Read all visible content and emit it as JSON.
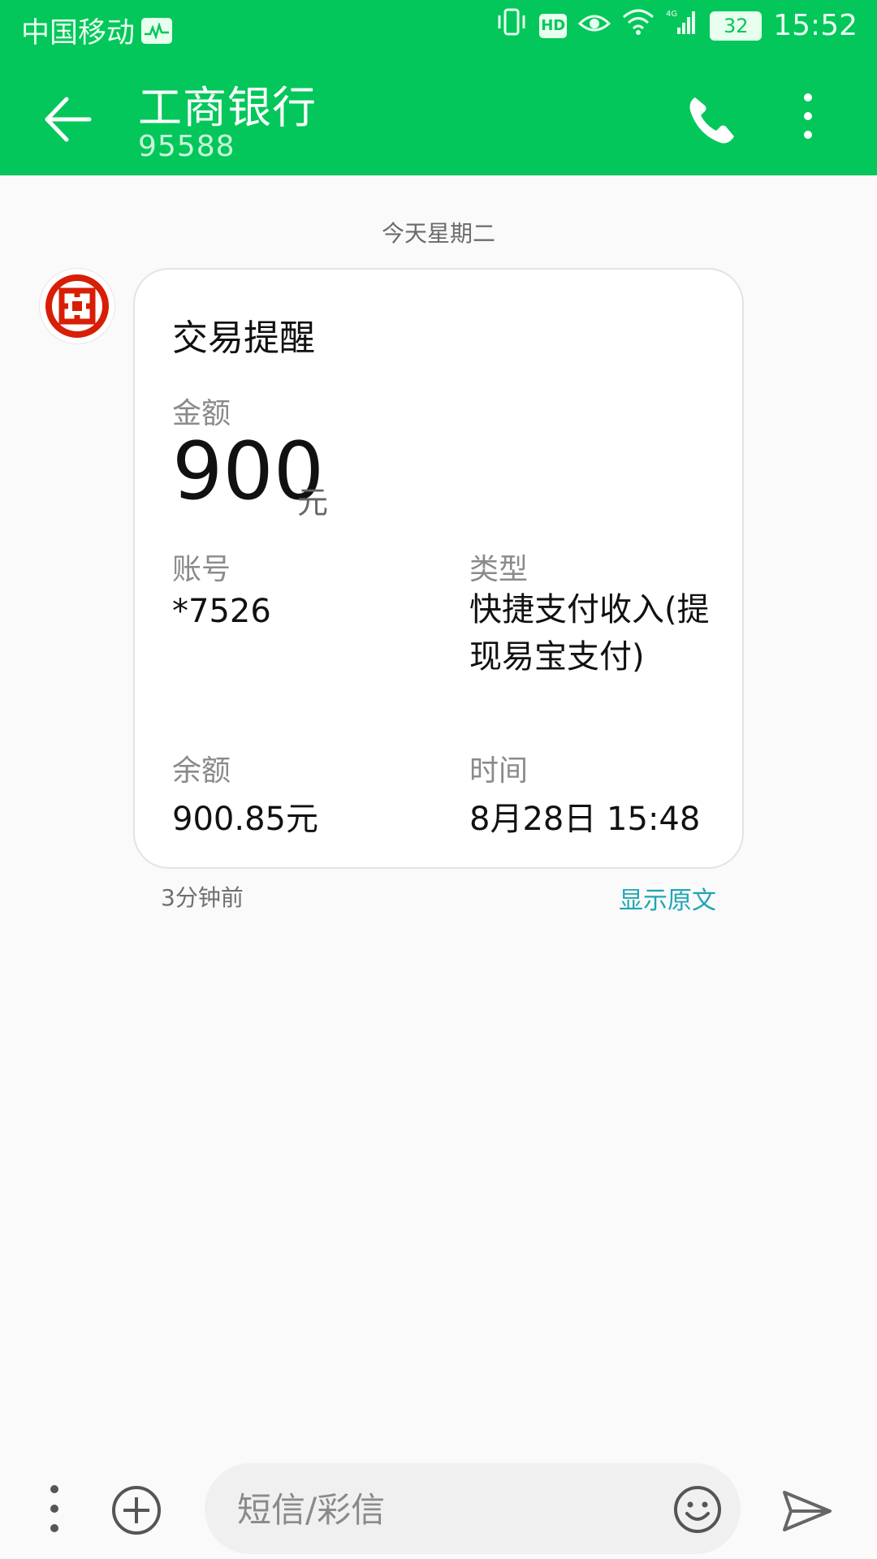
{
  "status_bar": {
    "carrier": "中国移动",
    "time": "15:52",
    "battery": "32",
    "hd": "HD",
    "network": "4G"
  },
  "header": {
    "title": "工商银行",
    "subtitle": "95588"
  },
  "conversation": {
    "date_separator": "今天星期二",
    "sent_ago": "3分钟前",
    "show_original": "显示原文"
  },
  "message": {
    "title": "交易提醒",
    "amount_label": "金额",
    "amount_value": "900",
    "amount_unit": "元",
    "account_label": "账号",
    "account_value": "*7526",
    "type_label": "类型",
    "type_value": "快捷支付收入(提现易宝支付)",
    "balance_label": "余额",
    "balance_value": "900.85元",
    "time_label": "时间",
    "time_value": "8月28日 15:48"
  },
  "composer": {
    "placeholder": "短信/彩信"
  },
  "colors": {
    "header_bg": "#03c75a",
    "link": "#1ea6b5",
    "bank_red": "#d81e06"
  }
}
